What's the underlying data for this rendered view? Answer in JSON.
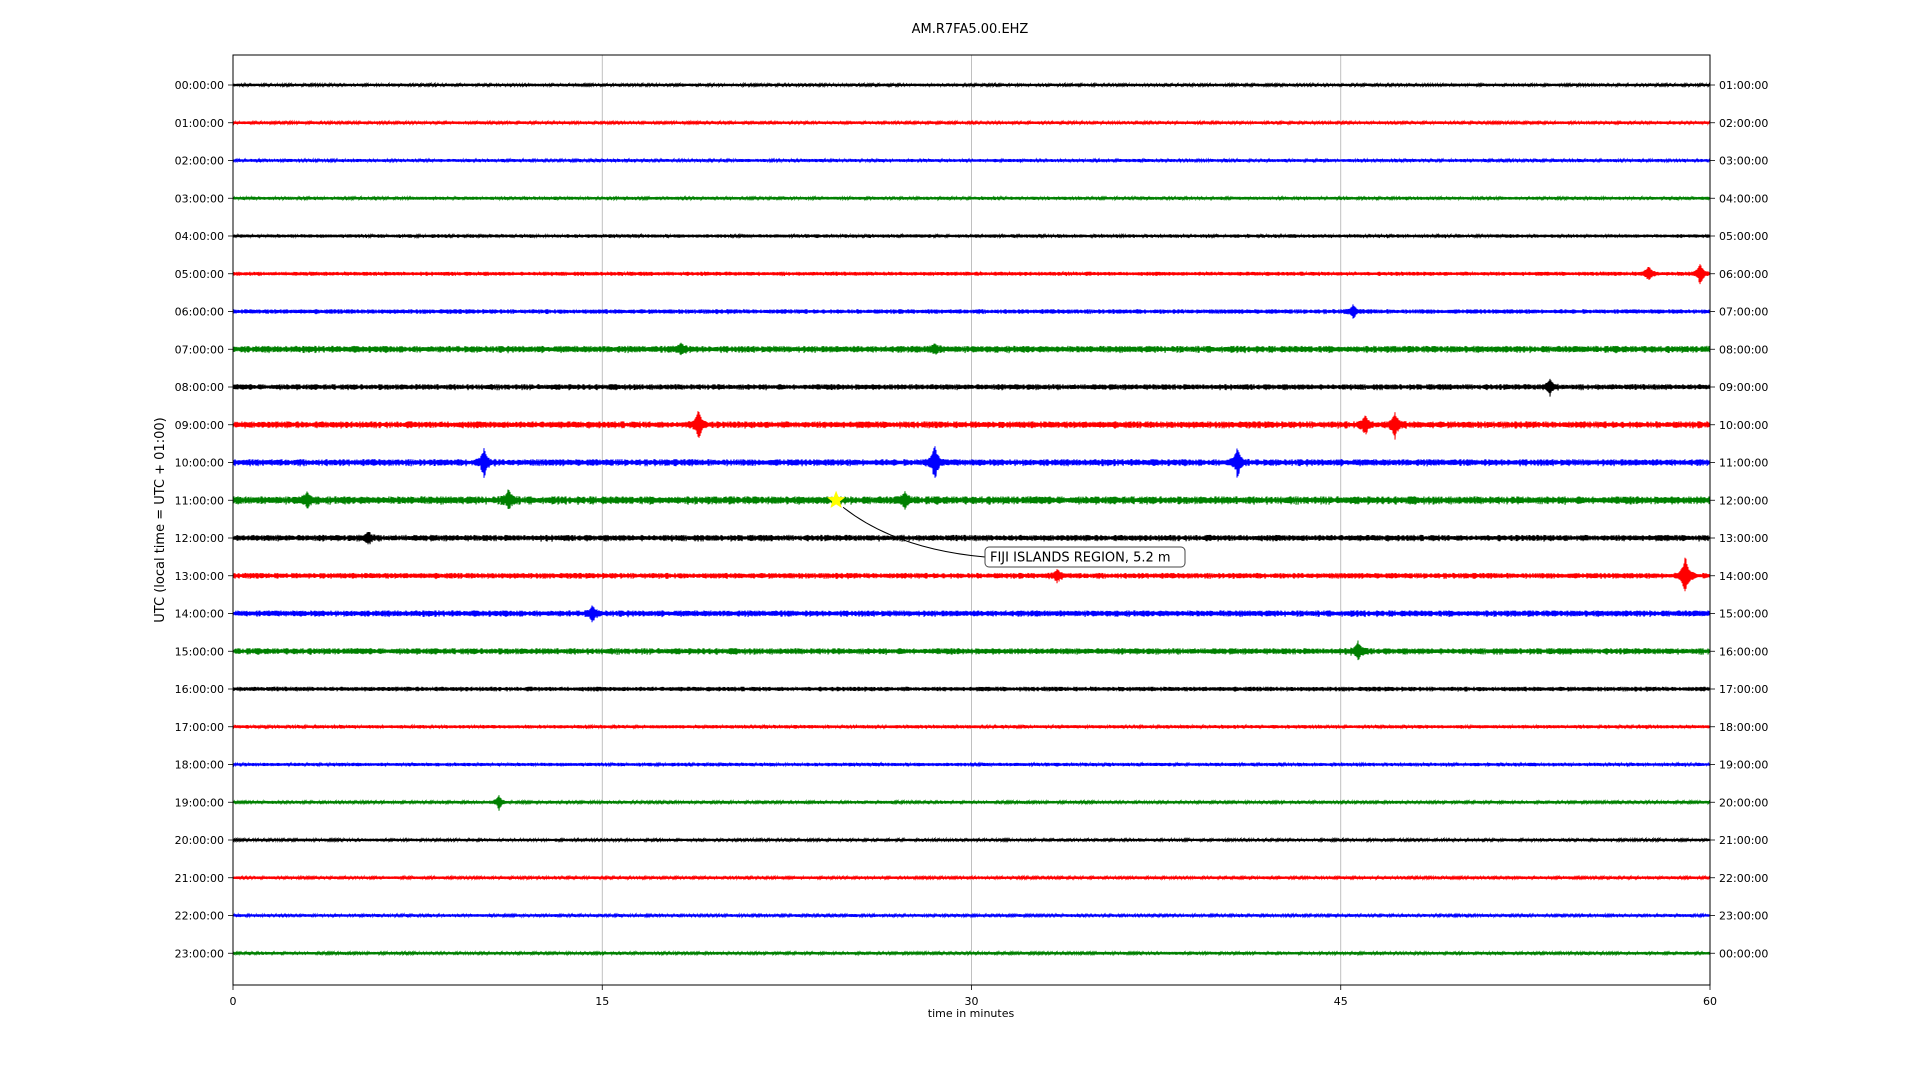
{
  "chart_data": {
    "type": "line",
    "title": "AM.R7FA5.00.EHZ",
    "xlabel": "time in minutes",
    "ylabel": "UTC (local time = UTC + 01:00)",
    "xlim": [
      0,
      60
    ],
    "xticks": [
      0,
      15,
      30,
      45,
      60
    ],
    "vertical_grid": true,
    "left_ticks": [
      "00:00:00",
      "01:00:00",
      "02:00:00",
      "03:00:00",
      "04:00:00",
      "05:00:00",
      "06:00:00",
      "07:00:00",
      "08:00:00",
      "09:00:00",
      "10:00:00",
      "11:00:00",
      "12:00:00",
      "13:00:00",
      "14:00:00",
      "15:00:00",
      "16:00:00",
      "17:00:00",
      "18:00:00",
      "19:00:00",
      "20:00:00",
      "21:00:00",
      "22:00:00",
      "23:00:00"
    ],
    "right_ticks": [
      "01:00:00",
      "02:00:00",
      "03:00:00",
      "04:00:00",
      "05:00:00",
      "06:00:00",
      "07:00:00",
      "08:00:00",
      "09:00:00",
      "10:00:00",
      "11:00:00",
      "12:00:00",
      "13:00:00",
      "14:00:00",
      "15:00:00",
      "16:00:00",
      "17:00:00",
      "18:00:00",
      "19:00:00",
      "20:00:00",
      "21:00:00",
      "22:00:00",
      "23:00:00",
      "00:00:00"
    ],
    "trace_colors": [
      "#000000",
      "#ff0000",
      "#0000ff",
      "#008000"
    ],
    "noise_levels": [
      1.0,
      1.0,
      1.1,
      1.1,
      1.2,
      1.4,
      1.6,
      2.4,
      2.0,
      2.4,
      2.4,
      2.8,
      2.2,
      2.0,
      2.2,
      2.2,
      1.6,
      1.2,
      1.2,
      1.0,
      1.0,
      1.0,
      1.0,
      1.0
    ],
    "spikes": [
      {
        "row": 5,
        "minute": 57.5,
        "amp": 7
      },
      {
        "row": 5,
        "minute": 59.6,
        "amp": 9
      },
      {
        "row": 6,
        "minute": 45.5,
        "amp": 5
      },
      {
        "row": 7,
        "minute": 18.2,
        "amp": 5
      },
      {
        "row": 7,
        "minute": 28.5,
        "amp": 4
      },
      {
        "row": 8,
        "minute": 53.5,
        "amp": 6
      },
      {
        "row": 9,
        "minute": 18.9,
        "amp": 13
      },
      {
        "row": 9,
        "minute": 46.0,
        "amp": 8
      },
      {
        "row": 9,
        "minute": 47.2,
        "amp": 10
      },
      {
        "row": 10,
        "minute": 10.2,
        "amp": 12
      },
      {
        "row": 10,
        "minute": 28.5,
        "amp": 16
      },
      {
        "row": 10,
        "minute": 40.8,
        "amp": 13
      },
      {
        "row": 11,
        "minute": 3.0,
        "amp": 6
      },
      {
        "row": 11,
        "minute": 11.2,
        "amp": 9
      },
      {
        "row": 11,
        "minute": 27.3,
        "amp": 6
      },
      {
        "row": 12,
        "minute": 5.5,
        "amp": 5
      },
      {
        "row": 13,
        "minute": 33.5,
        "amp": 5
      },
      {
        "row": 13,
        "minute": 59.0,
        "amp": 18
      },
      {
        "row": 14,
        "minute": 14.6,
        "amp": 6
      },
      {
        "row": 15,
        "minute": 45.7,
        "amp": 8
      },
      {
        "row": 19,
        "minute": 10.8,
        "amp": 6
      }
    ],
    "annotation": {
      "text": "FIJI ISLANDS REGION, 5.2 m",
      "minute": 24.5,
      "row": 11,
      "marker": "star",
      "marker_color": "#ffff00"
    }
  }
}
